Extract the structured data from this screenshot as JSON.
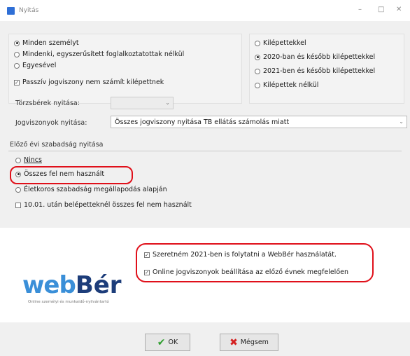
{
  "window": {
    "title": "Nyitás",
    "minimize_glyph": "–",
    "maximize_glyph": "□",
    "close_glyph": "✕"
  },
  "scope": {
    "options": [
      {
        "label": "Minden személyt",
        "selected": true
      },
      {
        "label": "Mindenki, egyszerűsített foglalkoztatottak nélkül",
        "selected": false
      },
      {
        "label": "Egyesével",
        "selected": false
      }
    ],
    "passive_checkbox": {
      "label": "Passzív jogviszony nem számít kilépettnek",
      "checked": true
    }
  },
  "exit_filter": {
    "options": [
      {
        "label": "Kilépettekkel",
        "selected": false
      },
      {
        "label": "2020-ban és később kilépettekkel",
        "selected": true
      },
      {
        "label": "2021-ben és később kilépettekkel",
        "selected": false
      },
      {
        "label": "Kilépettek nélkül",
        "selected": false
      }
    ]
  },
  "fields": {
    "torzsberek_label": "Törzsbérek nyitása:",
    "torzsberek_value": "",
    "jogviszonyok_label": "Jogviszonyok nyitása:",
    "jogviszonyok_value": "Összes jogviszony nyitása TB ellátás számolás miatt"
  },
  "leave": {
    "section_title": "Előző évi szabadság nyitása",
    "options": [
      {
        "label": "Nincs",
        "selected": false
      },
      {
        "label": "Összes fel nem használt",
        "selected": true
      },
      {
        "label": "Életkoros szabadság megállapodás alapján",
        "selected": false
      }
    ],
    "after_date_checkbox": {
      "label": "10.01. után belépetteknél összes fel nem használt",
      "checked": false
    }
  },
  "webber": {
    "continue_checkbox": {
      "label": "Szeretném 2021-ben is folytatni a WebBér használatát.",
      "checked": true
    },
    "online_checkbox": {
      "label": "Online jogviszonyok beállítása az előző évnek megfelelően",
      "checked": true
    },
    "logo_part1": "web",
    "logo_part2": "Bér",
    "logo_tagline": "Online személyi és munkaidő-nyilvántartó"
  },
  "buttons": {
    "ok_label": "OK",
    "cancel_label": "Mégsem"
  },
  "colors": {
    "ok_icon": "#2e9e2e",
    "cancel_icon": "#d42020",
    "highlight": "#e0101a",
    "logo_blue": "#3a8fd8",
    "logo_navy": "#1d3d7a"
  }
}
